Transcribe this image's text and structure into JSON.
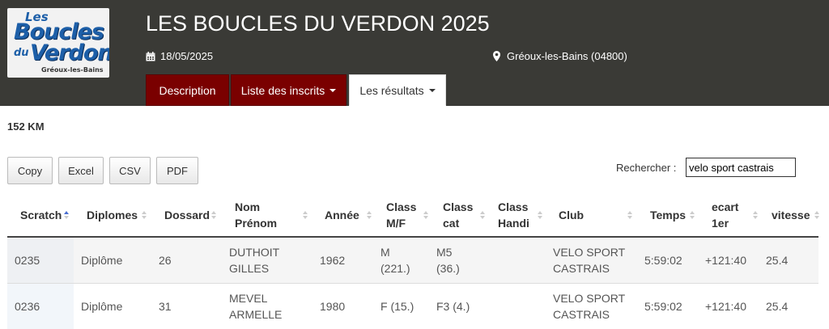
{
  "event": {
    "logo": {
      "line1": "Les",
      "line2": "Boucles",
      "line3": "du",
      "line4": "Verdon",
      "line5": "Gréoux-les-Bains"
    },
    "title": "LES BOUCLES DU VERDON 2025",
    "date": "18/05/2025",
    "location": "Gréoux-les-Bains (04800)"
  },
  "tabs": [
    {
      "label": "Description"
    },
    {
      "label": "Liste des inscrits"
    },
    {
      "label": "Les résultats"
    }
  ],
  "distance": "152 KM",
  "buttons": {
    "copy": "Copy",
    "excel": "Excel",
    "csv": "CSV",
    "pdf": "PDF"
  },
  "search": {
    "label": "Rechercher :",
    "value": "velo sport castrais"
  },
  "columns": {
    "scratch": "Scratch",
    "diplomes": "Diplomes",
    "dossard": "Dossard",
    "nom_l1": "Nom",
    "nom_l2": "Prénom",
    "annee": "Année",
    "classmf_l1": "Class",
    "classmf_l2": "M/F",
    "classcat_l1": "Class",
    "classcat_l2": "cat",
    "classhandi_l1": "Class",
    "classhandi_l2": "Handi",
    "club": "Club",
    "temps": "Temps",
    "ecart_l1": "ecart",
    "ecart_l2": "1er",
    "vitesse": "vitesse"
  },
  "rows": [
    {
      "scratch": "0235",
      "diplome": "Diplôme",
      "dossard": "26",
      "nom": "DUTHOIT",
      "prenom": "GILLES",
      "annee": "1962",
      "classmf_l1": "M",
      "classmf_l2": "(221.)",
      "classcat_l1": "M5",
      "classcat_l2": "(36.)",
      "classhandi": "",
      "club_l1": "VELO SPORT",
      "club_l2": "CASTRAIS",
      "temps": "5:59:02",
      "ecart": "+121:40",
      "vitesse": "25.4"
    },
    {
      "scratch": "0236",
      "diplome": "Diplôme",
      "dossard": "31",
      "nom": "MEVEL",
      "prenom": "ARMELLE",
      "annee": "1980",
      "classmf_l1": "F (15.)",
      "classmf_l2": "",
      "classcat_l1": "F3 (4.)",
      "classcat_l2": "",
      "classhandi": "",
      "club_l1": "VELO SPORT",
      "club_l2": "CASTRAIS",
      "temps": "5:59:02",
      "ecart": "+121:40",
      "vitesse": "25.4"
    }
  ]
}
